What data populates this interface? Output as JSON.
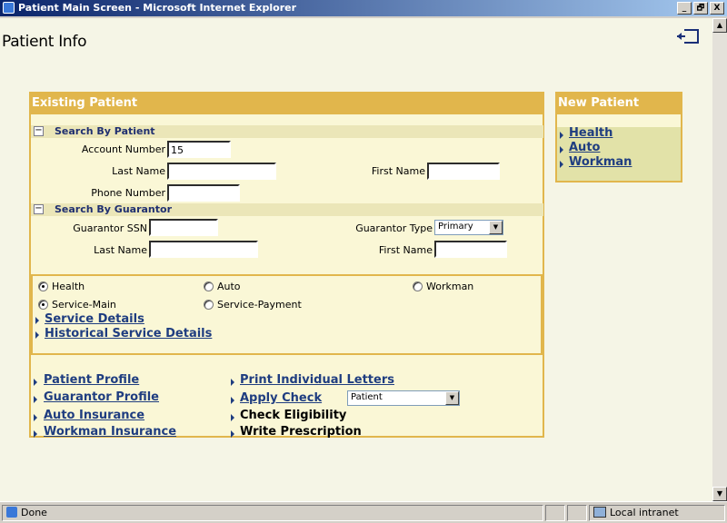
{
  "window": {
    "title": "Patient Main Screen - Microsoft Internet Explorer",
    "buttons": [
      "_",
      "🗗",
      "X"
    ]
  },
  "page": {
    "title": "Patient Info",
    "logout_icon": "exit-icon"
  },
  "existing": {
    "header": "Existing Patient",
    "search_patient": {
      "title": "Search By Patient",
      "toggle": "−",
      "account_label": "Account Number",
      "account_value": "15",
      "last_label": "Last Name",
      "last_value": "",
      "first_label": "First Name",
      "first_value": "",
      "phone_label": "Phone Number",
      "phone_value": ""
    },
    "search_guarantor": {
      "title": "Search By Guarantor",
      "toggle": "−",
      "ssn_label": "Guarantor SSN",
      "ssn_value": "",
      "type_label": "Guarantor Type",
      "type_value": "Primary",
      "last_label": "Last Name",
      "last_value": "",
      "first_label": "First Name",
      "first_value": ""
    },
    "types": {
      "health": "Health",
      "auto": "Auto",
      "workman": "Workman",
      "selected": "Health"
    },
    "service": {
      "main": "Service-Main",
      "payment": "Service-Payment",
      "selected": "Service-Main"
    },
    "detail_links": [
      "Service Details",
      "Historical Service Details "
    ],
    "actions_left": [
      "Patient Profile",
      "Guarantor Profile",
      "Auto Insurance",
      "Workman Insurance"
    ],
    "actions_right": {
      "print": "Print Individual Letters",
      "apply": "Apply Check ",
      "apply_select": "Patient",
      "eligibility": "Check Eligibility",
      "prescription": "Write Prescription"
    }
  },
  "new_patient": {
    "header": "New Patient",
    "links": [
      "Health",
      "Auto",
      "Workman"
    ]
  },
  "status": {
    "text": "Done",
    "zone": "Local intranet"
  },
  "colors": {
    "panel_header": "#e1b64c",
    "panel_bg": "#faf7d6",
    "link": "#1f3d80"
  }
}
